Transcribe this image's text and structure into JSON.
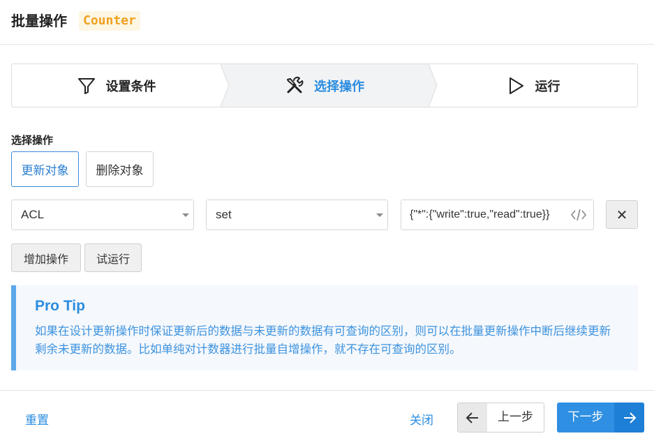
{
  "header": {
    "title": "批量操作",
    "badge": "Counter"
  },
  "steps": [
    {
      "label": "设置条件",
      "icon": "filter-icon",
      "active": false
    },
    {
      "label": "选择操作",
      "icon": "tools-icon",
      "active": true
    },
    {
      "label": "运行",
      "icon": "play-icon",
      "active": false
    }
  ],
  "operation": {
    "section_label": "选择操作",
    "options": [
      "更新对象",
      "删除对象"
    ],
    "selected": "更新对象"
  },
  "row": {
    "field": "ACL",
    "op": "set",
    "value": "{\"*\":{\"write\":true,\"read\":true}}",
    "remove_label": "✕"
  },
  "actions": {
    "add": "增加操作",
    "dry_run": "试运行"
  },
  "tip": {
    "title": "Pro Tip",
    "body": "如果在设计更新操作时保证更新后的数据与未更新的数据有可查询的区别，则可以在批量更新操作中断后继续更新剩余未更新的数据。比如单纯对计数器进行批量自增操作，就不存在可查询的区别。"
  },
  "footer": {
    "reset": "重置",
    "close": "关闭",
    "prev": "上一步",
    "next": "下一步"
  },
  "colors": {
    "accent": "#2a8ce0",
    "badge_bg": "#fdf6e3",
    "badge_text": "#f0a020",
    "tip_border": "#5aa7ea",
    "tip_bg": "#f5f8fc"
  }
}
